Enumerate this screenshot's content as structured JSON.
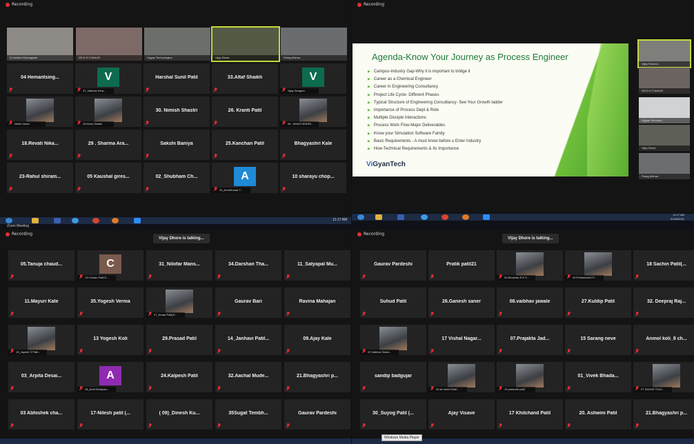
{
  "quadrants": {
    "top_left": {
      "recording": "Recording",
      "videos": [
        {
          "name": "Dr.Ashish Khobragade"
        },
        {
          "name": "DR.D.S.THAKUR"
        },
        {
          "name": "Vigyan Technologies"
        },
        {
          "name": "Vijay Dhore"
        },
        {
          "name": "Parag Ahirrao"
        }
      ],
      "tiles": [
        {
          "label": "04 Hemantsing...",
          "kind": "name"
        },
        {
          "label": "V",
          "kind": "avatar",
          "caption": "37_Vaibhav Kina...",
          "color": "#0e6b4f"
        },
        {
          "label": "Harshal Sunil Patil",
          "kind": "name"
        },
        {
          "label": "33.Altaf Shaikh",
          "kind": "name"
        },
        {
          "label": "V",
          "kind": "avatar",
          "caption": "Vijay Sangore",
          "color": "#0e6b4f"
        },
        {
          "label": "",
          "kind": "photo",
          "caption": "Nikhil Ghare"
        },
        {
          "label": "",
          "kind": "photo",
          "caption": "26.Kiran Shaikh"
        },
        {
          "label": "30. Nimish Shastri",
          "kind": "name"
        },
        {
          "label": "26. Kranti Patil",
          "kind": "name"
        },
        {
          "label": "",
          "kind": "photo",
          "caption": "06 - BHAGYASHRI..."
        },
        {
          "label": "18.Revati Nika...",
          "kind": "name"
        },
        {
          "label": "29 . Sharma Ara...",
          "kind": "name"
        },
        {
          "label": "Sakshi Baniya",
          "kind": "name"
        },
        {
          "label": "25.Kanchan Patil",
          "kind": "name"
        },
        {
          "label": "Bhagyashri Kale",
          "kind": "name"
        },
        {
          "label": "23-Rahul shiram...",
          "kind": "name"
        },
        {
          "label": "05 Kaushal gires...",
          "kind": "name"
        },
        {
          "label": "02_Shubham Ch...",
          "kind": "name"
        },
        {
          "label": "A",
          "kind": "avatar",
          "caption": "24_AmolKumar T...",
          "color": "#1f8ad6"
        },
        {
          "label": "10 sharayu chop...",
          "kind": "name"
        }
      ],
      "window_title": "Zoom Meeting"
    },
    "top_right": {
      "recording": "Recording",
      "slide_title": "Agenda-Know Your Journey as Process Engineer",
      "slide_items": [
        "Campus-Industry Gap-Why it is important to bridge it",
        "Career as a Chemical Engineer",
        "Career in Engineering Consultancy",
        "Project Life Cycle- Different Phases",
        "Typical Structure of Engineering Consultancy- See Your Growth ladder",
        "Importance of Process Dept & Role",
        "Multiple Disciple Interactions",
        "Process Work Flow-Major Deliverables",
        "Know your Simulation Software Family",
        "Basic Requirements - A must know before u Enter Industry",
        "How-Technical Requirements & Its Importance"
      ],
      "logo_a": "Vi",
      "logo_b": "GyanTech",
      "side_videos": [
        {
          "name": "Vijay Technol..."
        },
        {
          "name": "DR.D.S.THAKUR"
        },
        {
          "name": "Vigyan Technolo..."
        },
        {
          "name": "Vijay Dhore"
        },
        {
          "name": "Parag Ahirrao"
        }
      ]
    },
    "bottom_left": {
      "recording": "Recording",
      "talking": "Vijay Dhore is talking...",
      "tiles": [
        {
          "label": "05.Tanuja chaud...",
          "kind": "name"
        },
        {
          "label": "C",
          "kind": "avatar",
          "caption": "13 Chetan Patil E...",
          "color": "#7a5a4c"
        },
        {
          "label": "31_Nilofar Mans...",
          "kind": "name"
        },
        {
          "label": "34.Darshan Tha...",
          "kind": "name"
        },
        {
          "label": "11_Satyapal Mu...",
          "kind": "name"
        },
        {
          "label": "11.Mayuri Kate",
          "kind": "name"
        },
        {
          "label": "35.Yogesh Verma",
          "kind": "name"
        },
        {
          "label": "",
          "kind": "photo",
          "caption": "27_Kedar Patil(D..."
        },
        {
          "label": "Gaurav Bari",
          "kind": "name"
        },
        {
          "label": "Ravina Mahajan",
          "kind": "name"
        },
        {
          "label": "",
          "kind": "photo",
          "caption": "15_Jayesh S Patil..."
        },
        {
          "label": "13 Yogesh Koli",
          "kind": "name"
        },
        {
          "label": "29.Prasad Patil",
          "kind": "name"
        },
        {
          "label": "14_Janhavi Patil...",
          "kind": "name"
        },
        {
          "label": "09.Ajay Kale",
          "kind": "name"
        },
        {
          "label": "03_Arpita Desai...",
          "kind": "name"
        },
        {
          "label": "A",
          "kind": "avatar",
          "caption": "28_Amit Deshpan...",
          "color": "#8e2bb0"
        },
        {
          "label": "24.Kalpesh Patil",
          "kind": "name"
        },
        {
          "label": "32.Aachal Mude...",
          "kind": "name"
        },
        {
          "label": "21.Bhagyashri p...",
          "kind": "name"
        },
        {
          "label": "03 Abhishek cha...",
          "kind": "name"
        },
        {
          "label": "17-Nilesh patil (...",
          "kind": "name"
        },
        {
          "label": "( 09)_Dinesh Ku...",
          "kind": "name"
        },
        {
          "label": "35Sugat Tembh...",
          "kind": "name"
        },
        {
          "label": "Gaurav Pardeshi",
          "kind": "name"
        }
      ]
    },
    "bottom_right": {
      "recording": "Recording",
      "talking": "Vijay Dhore is talking...",
      "tiles": [
        {
          "label": "Gaurav Pardeshi",
          "kind": "name"
        },
        {
          "label": "Pratik patil21",
          "kind": "name"
        },
        {
          "label": "",
          "kind": "photo",
          "caption": "04 Bhushan R.K C..."
        },
        {
          "label": "",
          "kind": "photo",
          "caption": "20 PrathamesH P..."
        },
        {
          "label": "18 Sachin Patil(...",
          "kind": "name"
        },
        {
          "label": "Suhud Patil",
          "kind": "name"
        },
        {
          "label": "26.Ganesh saner",
          "kind": "name"
        },
        {
          "label": "08.vaibhav jawale",
          "kind": "name"
        },
        {
          "label": "27.Kuldip Patil",
          "kind": "name"
        },
        {
          "label": "32. Deepraj Raj...",
          "kind": "name"
        },
        {
          "label": "",
          "kind": "photo",
          "caption": "22 Vaibhav Salun..."
        },
        {
          "label": "17 Vishal  Nagar...",
          "kind": "name"
        },
        {
          "label": "07.Prajakta Jad...",
          "kind": "name"
        },
        {
          "label": "15 Sarang neve",
          "kind": "name"
        },
        {
          "label": "Anmol koli_8 ch...",
          "kind": "name"
        },
        {
          "label": "sandip badgujar",
          "kind": "name"
        },
        {
          "label": "",
          "kind": "photo",
          "caption": "34.sk mohd Sadi..."
        },
        {
          "label": "",
          "kind": "photo",
          "caption": "10 prashant patil"
        },
        {
          "label": "01_Vivek Bhada...",
          "kind": "name"
        },
        {
          "label": "",
          "kind": "photo",
          "caption": "27 SAGAR TULE..."
        },
        {
          "label": "30_Suyog Patil (...",
          "kind": "name"
        },
        {
          "label": "Ajay Visave",
          "kind": "name"
        },
        {
          "label": "17 Khilchand Patil",
          "kind": "name"
        },
        {
          "label": "20. Ashwini Patil",
          "kind": "name"
        },
        {
          "label": "21.Bhagyashri p...",
          "kind": "name"
        }
      ],
      "tooltip": "Windows Media Player"
    }
  },
  "taskbar": {
    "time_left": "11:17 AM",
    "time_right": "11:17 AM",
    "date_right": "01/06/2021"
  }
}
